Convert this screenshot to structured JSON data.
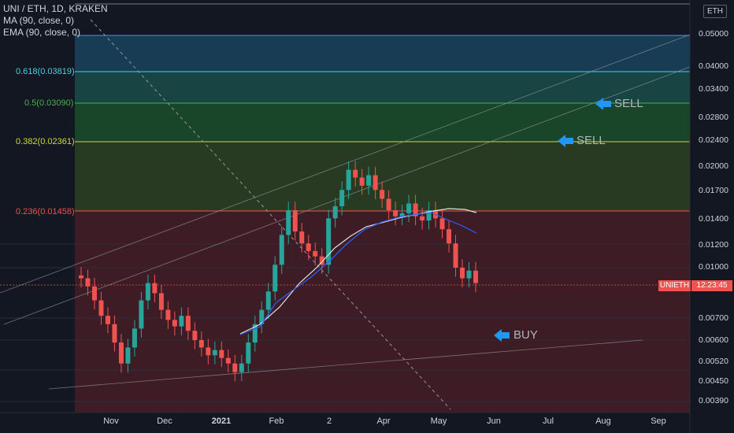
{
  "header": {
    "symbol_title": "UNI / ETH, 1D, KRAKEN",
    "indicators": [
      "MA (90, close, 0)",
      "EMA (90, close, 0)"
    ]
  },
  "price_scale": {
    "currency": "ETH",
    "ticks": [
      "0.05000",
      "0.04000",
      "0.03400",
      "0.02800",
      "0.02400",
      "0.02000",
      "0.01700",
      "0.01400",
      "0.01200",
      "0.01000",
      "0.00700",
      "0.00600",
      "0.00520",
      "0.00450",
      "0.00390"
    ],
    "last_price": "12:23:45",
    "symbol_tag": "UNIETH"
  },
  "time_axis": {
    "labels": [
      "Nov",
      "Dec",
      "2021",
      "Feb",
      "2",
      "Apr",
      "May",
      "Jun",
      "Jul",
      "Aug",
      "Sep"
    ]
  },
  "fib_levels": [
    {
      "label": "0.618(0.03819)",
      "color": "#4dd0e1"
    },
    {
      "label": "0.5(0.03090)",
      "color": "#4caf50"
    },
    {
      "label": "0.382(0.02361)",
      "color": "#cddc39"
    },
    {
      "label": "0.236(0.01458)",
      "color": "#ef5350"
    }
  ],
  "annotations": {
    "sell_upper": "SELL",
    "sell_lower": "SELL",
    "buy": "BUY"
  },
  "colors": {
    "up": "#26a69a",
    "down": "#ef5350",
    "ma": "#e0e0e0",
    "ema": "#2962ff",
    "arrow": "#2196f3"
  },
  "chart_data": {
    "type": "candlestick",
    "candles_approx": [
      0.0093,
      0.0088,
      0.008,
      0.0072,
      0.0068,
      0.006,
      0.0052,
      0.0058,
      0.0066,
      0.008,
      0.009,
      0.0084,
      0.0075,
      0.007,
      0.0067,
      0.0072,
      0.0065,
      0.0061,
      0.0058,
      0.0055,
      0.0057,
      0.0054,
      0.0052,
      0.0049,
      0.0052,
      0.006,
      0.0068,
      0.0075,
      0.0085,
      0.0102,
      0.0125,
      0.0148,
      0.0128,
      0.0118,
      0.0112,
      0.0108,
      0.0102,
      0.014,
      0.0152,
      0.017,
      0.0195,
      0.0185,
      0.0175,
      0.0188,
      0.017,
      0.016,
      0.0148,
      0.0142,
      0.0145,
      0.0155,
      0.0142,
      0.0138,
      0.0148,
      0.014,
      0.013,
      0.0118,
      0.01,
      0.0093,
      0.0098,
      0.009
    ]
  }
}
